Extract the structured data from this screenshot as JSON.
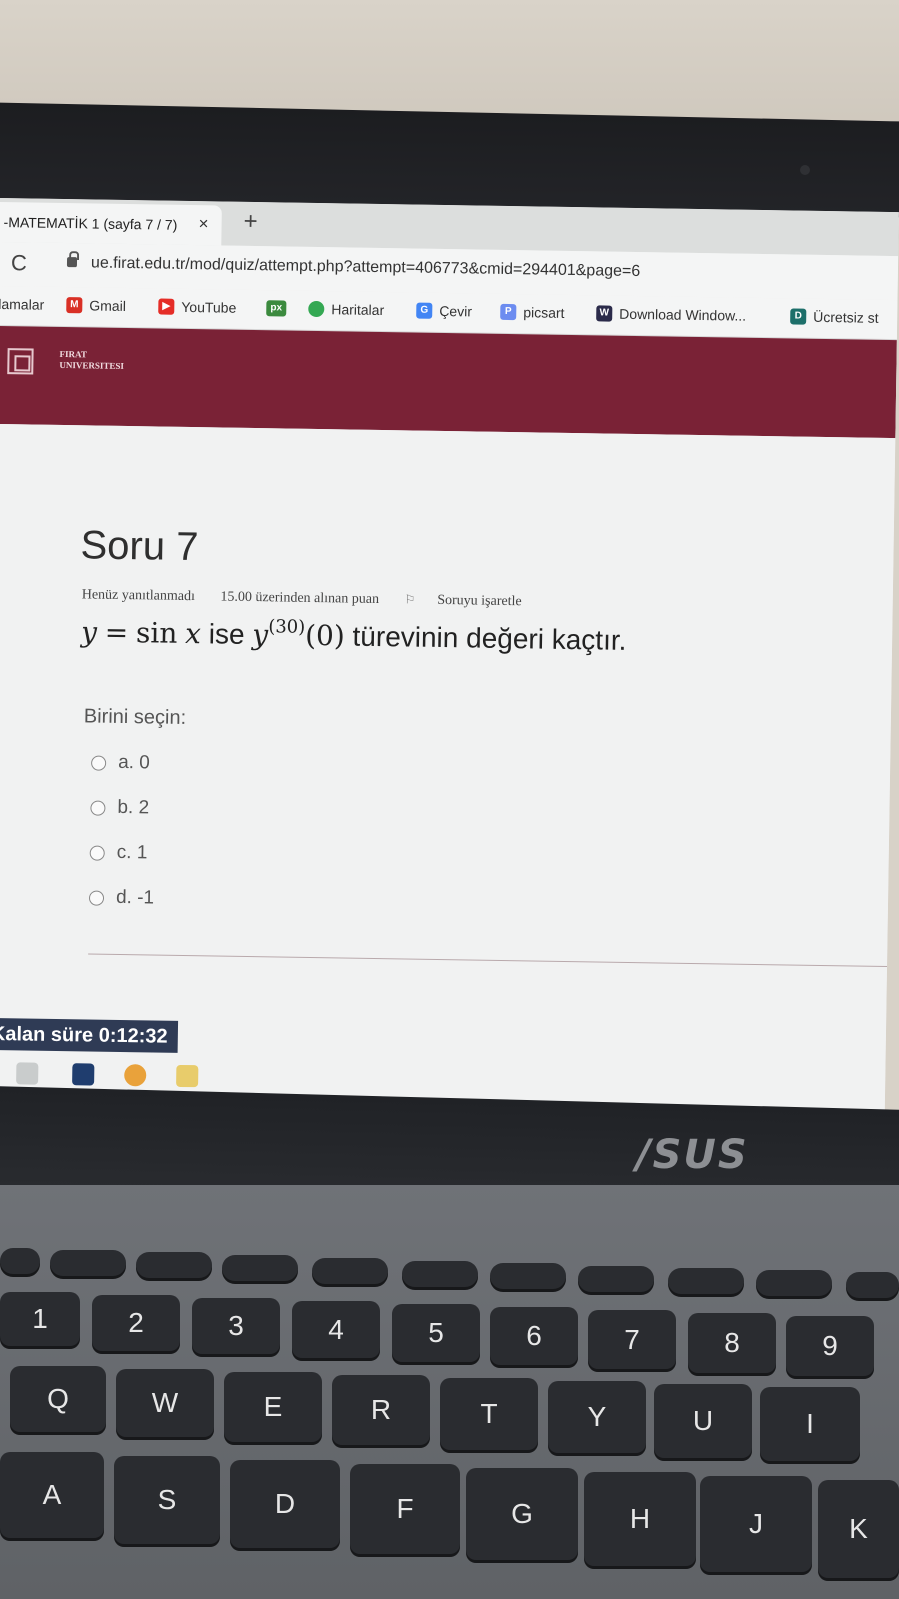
{
  "browser": {
    "tab_title": "-MATEMATİK 1 (sayfa 7 / 7)",
    "tab_close": "×",
    "new_tab": "+",
    "reload": "C",
    "url": "ue.firat.edu.tr/mod/quiz/attempt.php?attempt=406773&cmid=294401&page=6",
    "bookmarks": [
      {
        "label": "lamalar",
        "icon": ""
      },
      {
        "label": "Gmail",
        "icon": "gmail-icon",
        "color": "#d93025",
        "glyph": "M"
      },
      {
        "label": "YouTube",
        "icon": "youtube-icon",
        "color": "#e52d27",
        "glyph": "▶"
      },
      {
        "label": "",
        "icon": "px-icon",
        "color": "#3b8a3e",
        "glyph": "px"
      },
      {
        "label": "Haritalar",
        "icon": "maps-icon",
        "color": "#34a853",
        "glyph": "●"
      },
      {
        "label": "Çevir",
        "icon": "translate-icon",
        "color": "#4285f4",
        "glyph": "G"
      },
      {
        "label": "picsart",
        "icon": "picsart-icon",
        "color": "#6c8cf0",
        "glyph": "P"
      },
      {
        "label": "Download Window...",
        "icon": "download-icon",
        "color": "#2b2b4a",
        "glyph": "W"
      },
      {
        "label": "Ücretsiz st",
        "icon": "d-icon",
        "color": "#1d6f6a",
        "glyph": "D"
      }
    ]
  },
  "site": {
    "logo_line1": "FIRAT",
    "logo_line2": "UNIVERSITESI"
  },
  "question": {
    "title": "Soru 7",
    "status": "Henüz yanıtlanmadı",
    "points": "15.00 üzerinden alınan puan",
    "flag": "Soruyu işaretle",
    "text_y": "y",
    "text_eq": "=",
    "text_sin": "sin",
    "text_x": "x",
    "text_ise": "ise",
    "text_y2": "y",
    "text_order": "(30)",
    "text_arg": "(0)",
    "text_tail": "türevinin değeri kaçtır.",
    "prompt": "Birini seçin:",
    "answers": [
      "a. 0",
      "b. 2",
      "c. 1",
      "d. -1"
    ]
  },
  "timer": {
    "label": "Kalan süre",
    "value": "0:12:32"
  },
  "laptop": {
    "brand": "/SUS",
    "keys_row1": [
      "1",
      "2",
      "3",
      "4",
      "5",
      "6",
      "7",
      "8",
      "9"
    ],
    "keys_row2": [
      "Q",
      "W",
      "E",
      "R",
      "T",
      "Y",
      "U",
      "I"
    ],
    "keys_row3": [
      "A",
      "S",
      "D",
      "F",
      "G",
      "H",
      "J",
      "K"
    ]
  }
}
